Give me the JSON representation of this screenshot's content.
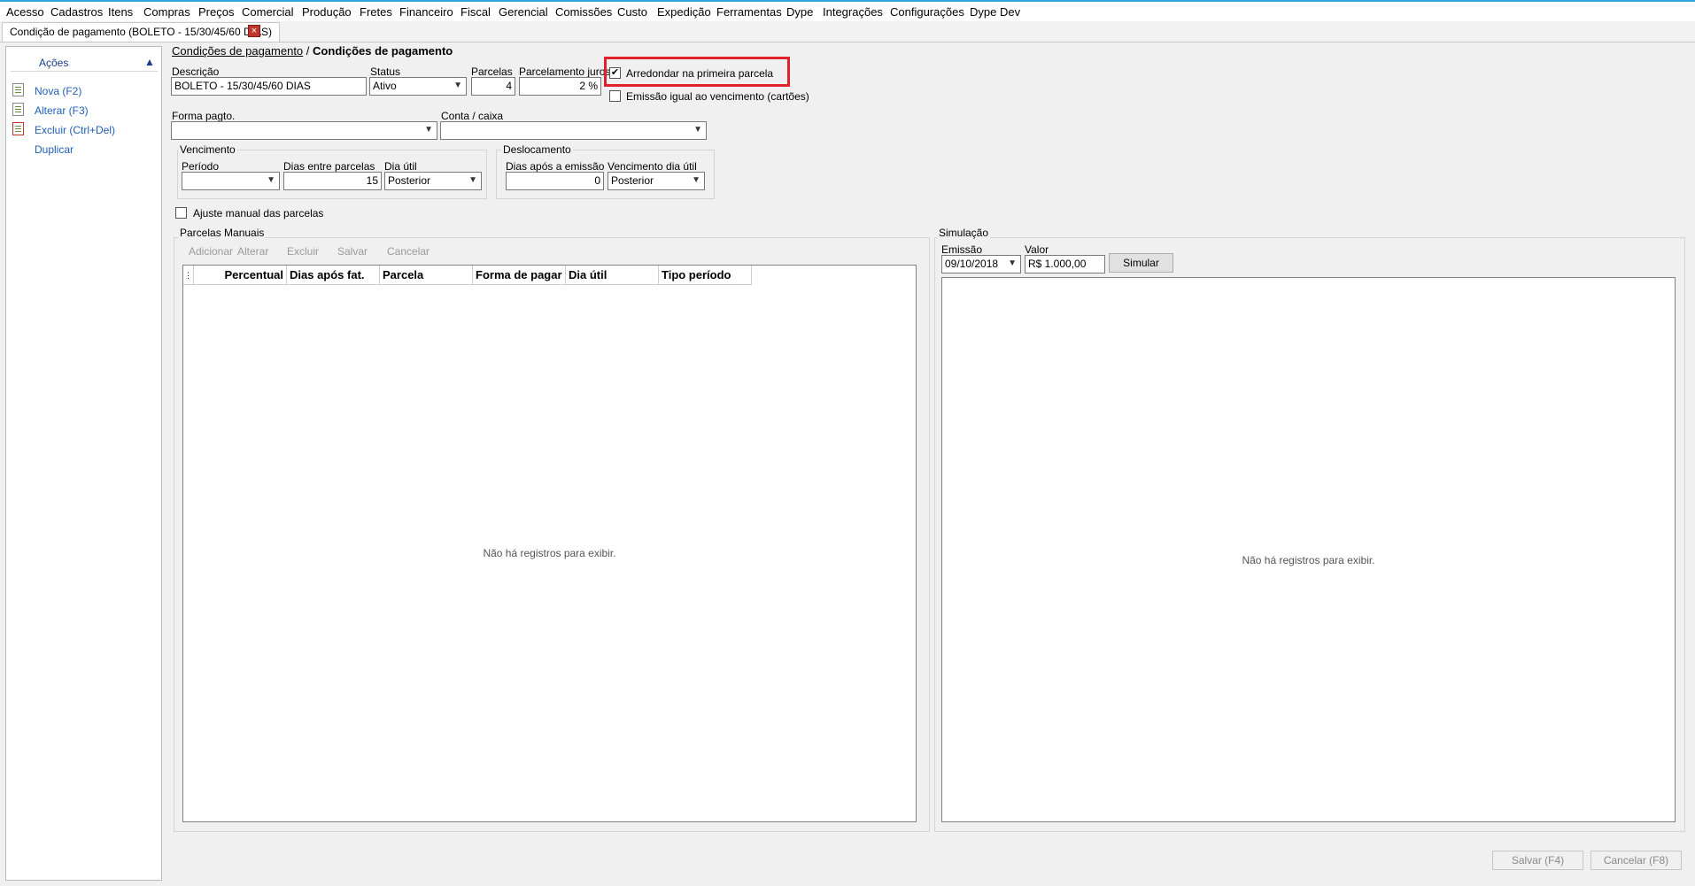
{
  "menu": [
    "Acesso",
    "Cadastros",
    "Itens",
    "Compras",
    "Preços",
    "Comercial",
    "Produção",
    "Fretes",
    "Financeiro",
    "Fiscal",
    "Gerencial",
    "Comissões",
    "Custo",
    "Expedição",
    "Ferramentas",
    "Dype",
    "Integrações",
    "Configurações",
    "Dype Dev"
  ],
  "tab": {
    "title": "Condição de pagamento (BOLETO - 15/30/45/60 DIAS)",
    "close": "×"
  },
  "sidebar": {
    "title": "Ações",
    "items": [
      {
        "label": "Nova (F2)",
        "icon": "document-new-icon"
      },
      {
        "label": "Alterar (F3)",
        "icon": "document-edit-icon"
      },
      {
        "label": "Excluir (Ctrl+Del)",
        "icon": "document-delete-icon"
      },
      {
        "label": "Duplicar",
        "icon": ""
      }
    ]
  },
  "breadcrumb": {
    "link": "Condições de pagamento",
    "sep": "/",
    "current": "Condições de pagamento"
  },
  "form": {
    "descricao_label": "Descrição",
    "descricao": "BOLETO - 15/30/45/60 DIAS",
    "status_label": "Status",
    "status": "Ativo",
    "parcelas_label": "Parcelas",
    "parcelas": "4",
    "juros_label": "Parcelamento juros",
    "juros": "2 %",
    "arredondar_label": "Arredondar na primeira parcela",
    "arredondar_checked": true,
    "emissao_igual_label": "Emissão igual ao vencimento (cartões)",
    "emissao_igual_checked": false,
    "forma_label": "Forma pagto.",
    "forma": "",
    "conta_label": "Conta / caixa",
    "conta": "",
    "vencimento": {
      "title": "Vencimento",
      "periodo_label": "Período",
      "periodo": "",
      "dias_label": "Dias entre parcelas",
      "dias": "15",
      "diautil_label": "Dia útil",
      "diautil": "Posterior"
    },
    "deslocamento": {
      "title": "Deslocamento",
      "dias_label": "Dias após a emissão",
      "dias": "0",
      "venc_label": "Vencimento dia útil",
      "venc": "Posterior"
    },
    "ajuste_label": "Ajuste manual das parcelas",
    "ajuste_checked": false
  },
  "parcelas_manuais": {
    "title": "Parcelas Manuais",
    "buttons": [
      "Adicionar",
      "Alterar",
      "Excluir",
      "Salvar",
      "Cancelar"
    ],
    "columns": [
      "Percentual",
      "Dias após fat.",
      "Parcela",
      "Forma de pagar",
      "Dia útil",
      "Tipo período"
    ],
    "empty": "Não há registros para exibir."
  },
  "simulacao": {
    "title": "Simulação",
    "emissao_label": "Emissão",
    "emissao": "09/10/2018",
    "valor_label": "Valor",
    "valor": "R$ 1.000,00",
    "button": "Simular",
    "empty": "Não há registros para exibir."
  },
  "footer": {
    "save": "Salvar (F4)",
    "cancel": "Cancelar (F8)"
  },
  "colors": {
    "highlight": "#e0222c",
    "accent": "#33a6e0",
    "link": "#1f5fb8"
  }
}
